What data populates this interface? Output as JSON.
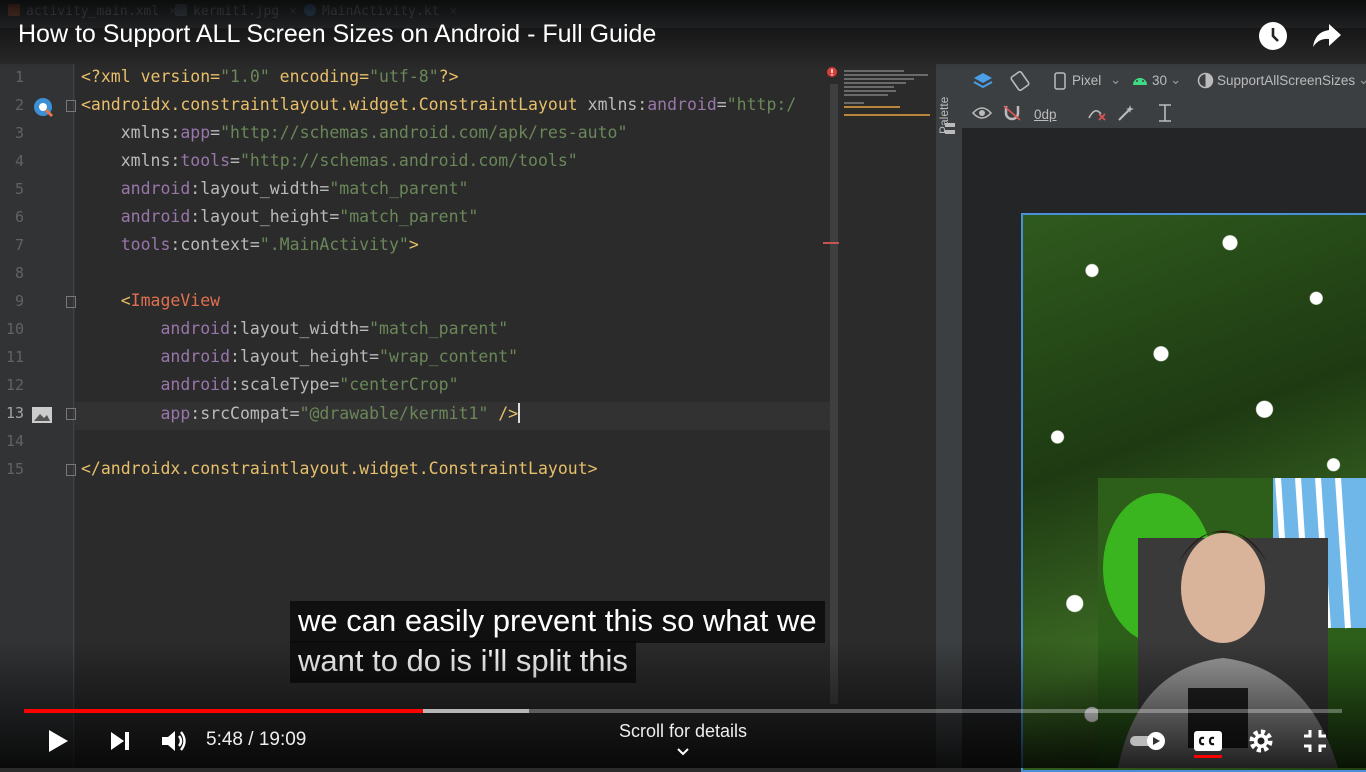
{
  "ide_tabs": [
    {
      "label": "activity_main.xml",
      "icon": "xml-file-icon",
      "color": "#e8754a"
    },
    {
      "label": "kermit1.jpg",
      "icon": "image-file-icon",
      "color": "#7a8a9a"
    },
    {
      "label": "MainActivity.kt",
      "icon": "kotlin-file-icon",
      "color": "#5b9bd5"
    }
  ],
  "video": {
    "title": "How to Support ALL Screen Sizes on Android - Full Guide",
    "current_time": "5:48",
    "duration": "19:09",
    "time_text": "5:48 / 19:09",
    "progress_fraction": 0.303,
    "buffered_fraction": 0.383,
    "scroll_hint": "Scroll for details",
    "captions": [
      "we can easily prevent this so what we",
      "want to do is i'll split this"
    ],
    "accent_color": "#ff0000"
  },
  "editor": {
    "line_numbers": [
      "1",
      "2",
      "3",
      "4",
      "5",
      "6",
      "7",
      "8",
      "9",
      "10",
      "11",
      "12",
      "13",
      "14",
      "15"
    ],
    "lines": {
      "l1a": "<?xml version=",
      "l1b": "\"1.0\"",
      "l1c": " encoding=",
      "l1d": "\"utf-8\"",
      "l1e": "?>",
      "l2a": "<androidx.constraintlayout.widget.ConstraintLayout",
      "l2b": " xmlns:",
      "l2c": "android",
      "l2d": "=",
      "l2e": "\"http:/",
      "l3a": "    xmlns:",
      "l3b": "app",
      "l3c": "=",
      "l3d": "\"http://schemas.android.com/apk/res-auto\"",
      "l4a": "    xmlns:",
      "l4b": "tools",
      "l4c": "=",
      "l4d": "\"http://schemas.android.com/tools\"",
      "l5a": "    android",
      "l5b": ":layout_width=",
      "l5c": "\"match_parent\"",
      "l6a": "    android",
      "l6b": ":layout_height=",
      "l6c": "\"match_parent\"",
      "l7a": "    tools",
      "l7b": ":context=",
      "l7c": "\".MainActivity\"",
      "l7d": ">",
      "l9a": "    <",
      "l9b": "ImageView",
      "l10a": "        android",
      "l10b": ":layout_width=",
      "l10c": "\"match_parent\"",
      "l11a": "        android",
      "l11b": ":layout_height=",
      "l11c": "\"wrap_content\"",
      "l12a": "        android",
      "l12b": ":scaleType=",
      "l12c": "\"centerCrop\"",
      "l13a": "        app",
      "l13b": ":srcCompat=",
      "l13c": "\"@drawable/kermit1\"",
      "l13d": " />",
      "l15a": "</androidx.constraintlayout.widget.ConstraintLayout>"
    }
  },
  "design_panel": {
    "palette_label": "Palette",
    "device": "Pixel",
    "api_level": "30",
    "theme": "SupportAllScreenSizes",
    "margin_value": "0dp"
  }
}
